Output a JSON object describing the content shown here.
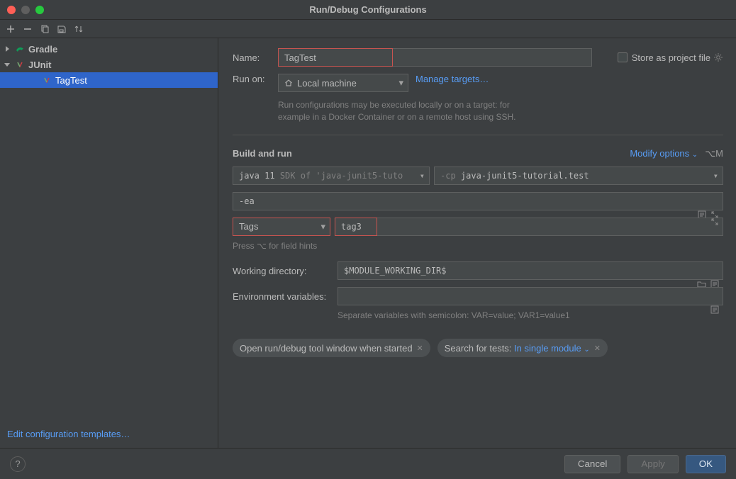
{
  "window": {
    "title": "Run/Debug Configurations"
  },
  "sidebar": {
    "items": [
      {
        "label": "Gradle",
        "expanded": false
      },
      {
        "label": "JUnit",
        "expanded": true,
        "children": [
          {
            "label": "TagTest",
            "selected": true
          }
        ]
      }
    ],
    "editTemplates": "Edit configuration templates…"
  },
  "form": {
    "nameLabel": "Name:",
    "nameValue": "TagTest",
    "storeAsProjectFile": "Store as project file",
    "runOnLabel": "Run on:",
    "runOnValue": "Local machine",
    "manageTargets": "Manage targets…",
    "runOnHint1": "Run configurations may be executed locally or on a target: for",
    "runOnHint2": "example in a Docker Container or on a remote host using SSH.",
    "buildAndRun": "Build and run",
    "modifyOptions": "Modify options",
    "modifyShortcut": "⌥M",
    "jdkPrefix": "java 11",
    "jdkSuffix": "SDK of 'java-junit5-tuto",
    "cpFlag": "-cp",
    "cpValue": "java-junit5-tutorial.test",
    "vmOptions": "-ea",
    "testKind": "Tags",
    "tagExpr": "tag3",
    "fieldHints": "Press ⌥ for field hints",
    "workingDirLabel": "Working directory:",
    "workingDirValue": "$MODULE_WORKING_DIR$",
    "envLabel": "Environment variables:",
    "envValue": "",
    "envHint": "Separate variables with semicolon: VAR=value; VAR1=value1",
    "chipOpenToolWindow": "Open run/debug tool window when started",
    "chipSearchPrefix": "Search for tests:",
    "chipSearchValue": "In single module"
  },
  "footer": {
    "cancel": "Cancel",
    "apply": "Apply",
    "ok": "OK"
  }
}
